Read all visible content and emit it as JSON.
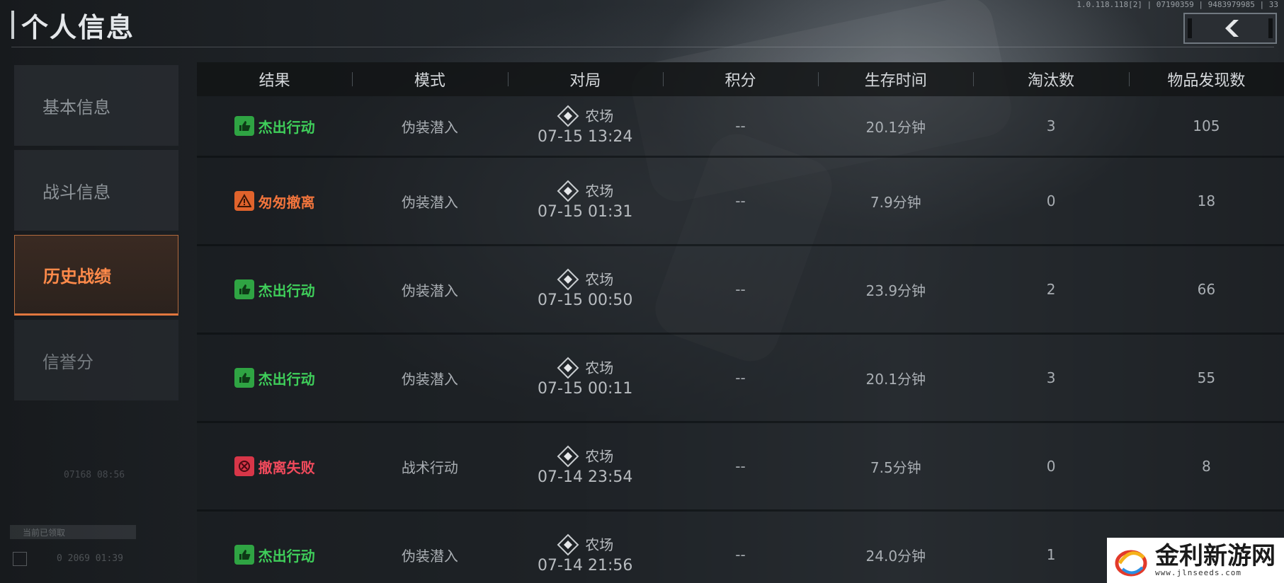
{
  "app": {
    "version": "1.0.118.118[2] | 07190359 | 9483979985 | 33"
  },
  "header": {
    "title": "个人信息"
  },
  "sidebar": {
    "items": [
      {
        "label": "基本信息",
        "active": false
      },
      {
        "label": "战斗信息",
        "active": false
      },
      {
        "label": "历史战绩",
        "active": true
      },
      {
        "label": "信誉分",
        "active": false
      }
    ],
    "faint_line": "07168 08:56",
    "bottom_label": "当前已领取",
    "bottom_time": "0  2069 01:39"
  },
  "table": {
    "columns": [
      "结果",
      "模式",
      "对局",
      "积分",
      "生存时间",
      "淘汰数",
      "物品发现数"
    ],
    "rows": [
      {
        "result": "杰出行动",
        "result_type": "good",
        "mode": "伪装潜入",
        "map": "农场",
        "time": "07-15 13:24",
        "score": "--",
        "survival": "20.1分钟",
        "kills": "3",
        "items": "105"
      },
      {
        "result": "匆匆撤离",
        "result_type": "warn",
        "mode": "伪装潜入",
        "map": "农场",
        "time": "07-15 01:31",
        "score": "--",
        "survival": "7.9分钟",
        "kills": "0",
        "items": "18"
      },
      {
        "result": "杰出行动",
        "result_type": "good",
        "mode": "伪装潜入",
        "map": "农场",
        "time": "07-15 00:50",
        "score": "--",
        "survival": "23.9分钟",
        "kills": "2",
        "items": "66"
      },
      {
        "result": "杰出行动",
        "result_type": "good",
        "mode": "伪装潜入",
        "map": "农场",
        "time": "07-15 00:11",
        "score": "--",
        "survival": "20.1分钟",
        "kills": "3",
        "items": "55"
      },
      {
        "result": "撤离失败",
        "result_type": "fail",
        "mode": "战术行动",
        "map": "农场",
        "time": "07-14 23:54",
        "score": "--",
        "survival": "7.5分钟",
        "kills": "0",
        "items": "8"
      },
      {
        "result": "杰出行动",
        "result_type": "good",
        "mode": "伪装潜入",
        "map": "农场",
        "time": "07-14 21:56",
        "score": "--",
        "survival": "24.0分钟",
        "kills": "1",
        "items": ""
      }
    ]
  },
  "watermark": {
    "name": "金利新游网",
    "url": "www.jlnseeds.com"
  },
  "colors": {
    "accent_orange": "#e2773e",
    "good_green": "#3fce5a",
    "warn_orange": "#f0743c",
    "fail_red": "#f04a5c"
  }
}
